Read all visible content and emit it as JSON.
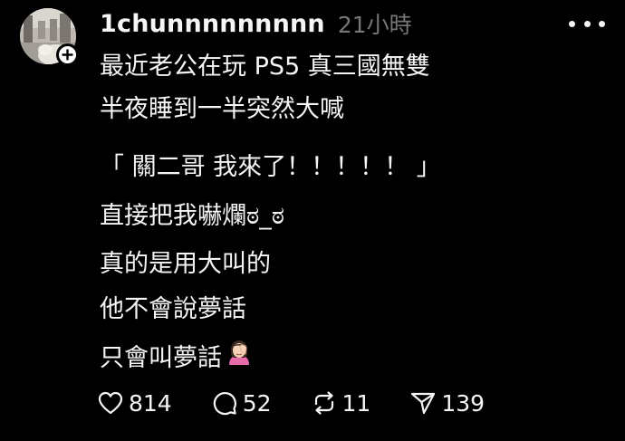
{
  "post": {
    "username": "1chunnnnnnnnn",
    "time": "21小時",
    "lines": [
      "最近老公在玩 PS5  真三國無雙",
      "半夜睡到一半突然大喊",
      "「  關二哥  我來了！！！！！  」",
      "直接把我嚇爛ಠ_ಠ",
      "真的是用大叫的",
      "他不會說夢話",
      "只會叫夢話"
    ],
    "icons": {
      "avatar": "profile-photo",
      "follow": "plus-icon",
      "more": "more-dots-icon",
      "like": "heart-icon",
      "reply": "comment-icon",
      "repost": "repost-icon",
      "share": "send-icon",
      "emoji": "face-palm-woman-emoji"
    }
  },
  "actions": {
    "likes": "814",
    "replies": "52",
    "reposts": "11",
    "shares": "139"
  },
  "colors": {
    "background": "#000000",
    "text": "#f3f5f7",
    "muted": "#777777"
  }
}
